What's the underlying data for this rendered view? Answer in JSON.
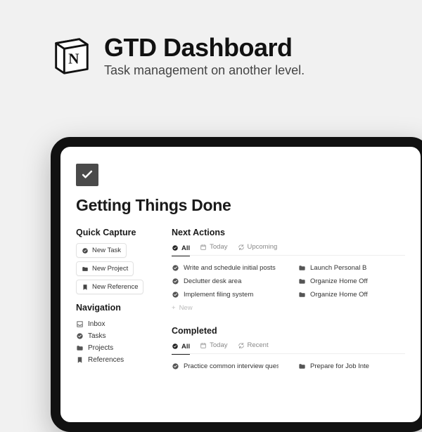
{
  "hero": {
    "title": "GTD Dashboard",
    "subtitle": "Task management on another level.",
    "logo_letter": "N"
  },
  "page": {
    "title": "Getting Things Done"
  },
  "quick_capture": {
    "title": "Quick Capture",
    "buttons": [
      {
        "label": "New Task",
        "icon": "check-circle"
      },
      {
        "label": "New Project",
        "icon": "folder"
      },
      {
        "label": "New Reference",
        "icon": "bookmark"
      }
    ]
  },
  "navigation": {
    "title": "Navigation",
    "items": [
      {
        "label": "Inbox",
        "icon": "inbox"
      },
      {
        "label": "Tasks",
        "icon": "check-circle"
      },
      {
        "label": "Projects",
        "icon": "folder"
      },
      {
        "label": "References",
        "icon": "bookmark"
      }
    ]
  },
  "next_actions": {
    "title": "Next Actions",
    "tabs": [
      {
        "label": "All",
        "icon": "check-circle",
        "active": true
      },
      {
        "label": "Today",
        "icon": "calendar",
        "active": false
      },
      {
        "label": "Upcoming",
        "icon": "refresh",
        "active": false
      }
    ],
    "left_tasks": [
      {
        "label": "Write and schedule initial posts",
        "icon": "check-circle"
      },
      {
        "label": "Declutter desk area",
        "icon": "check-circle"
      },
      {
        "label": "Implement filing system",
        "icon": "check-circle"
      }
    ],
    "right_tasks": [
      {
        "label": "Launch Personal B",
        "icon": "folder"
      },
      {
        "label": "Organize Home Off",
        "icon": "folder"
      },
      {
        "label": "Organize Home Off",
        "icon": "folder"
      }
    ],
    "new_label": "New"
  },
  "completed": {
    "title": "Completed",
    "tabs": [
      {
        "label": "All",
        "icon": "check-circle",
        "active": true
      },
      {
        "label": "Today",
        "icon": "calendar",
        "active": false
      },
      {
        "label": "Recent",
        "icon": "refresh",
        "active": false
      }
    ],
    "left_tasks": [
      {
        "label": "Practice common interview questions",
        "icon": "check-circle"
      }
    ],
    "right_tasks": [
      {
        "label": "Prepare for Job Inte",
        "icon": "folder"
      }
    ]
  }
}
